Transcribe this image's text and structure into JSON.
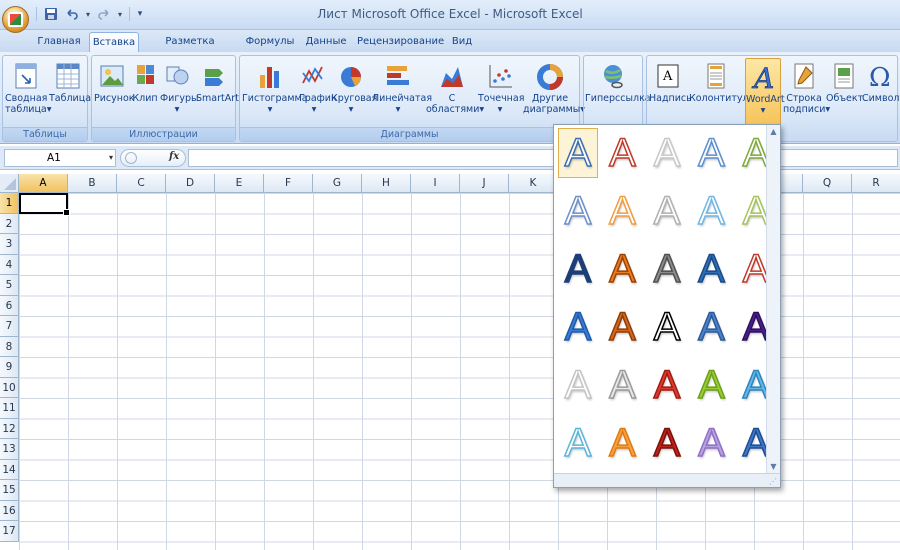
{
  "window": {
    "title": "Лист Microsoft Office Excel - Microsoft Excel"
  },
  "qat": {
    "save_icon": "save-icon",
    "undo_icon": "undo-icon",
    "redo_icon": "redo-icon"
  },
  "tabs": [
    {
      "label": "Главная"
    },
    {
      "label": "Вставка"
    },
    {
      "label": "Разметка страницы"
    },
    {
      "label": "Формулы"
    },
    {
      "label": "Данные"
    },
    {
      "label": "Рецензирование"
    },
    {
      "label": "Вид"
    }
  ],
  "ribbon": {
    "groups": {
      "tables": "Таблицы",
      "illustrations": "Иллюстрации",
      "charts": "Диаграммы"
    },
    "buttons": {
      "pivot_l1": "Сводная",
      "pivot_l2": "таблица",
      "table": "Таблица",
      "picture": "Рисунок",
      "clip": "Клип",
      "shapes": "Фигуры",
      "smartart": "SmartArt",
      "histogram": "Гистограмма",
      "graph": "График",
      "pie": "Круговая",
      "linear": "Линейчатая",
      "area_l1": "С",
      "area_l2": "областями",
      "scatter": "Точечная",
      "other_l1": "Другие",
      "other_l2": "диаграммы",
      "hyperlink": "Гиперссылка",
      "textbox": "Надпись",
      "header": "Колонтитулы",
      "wordart": "WordArt",
      "sigline_l1": "Строка",
      "sigline_l2": "подписи",
      "object": "Объект",
      "symbol": "Символ"
    },
    "dropdown_arrow": "▾"
  },
  "formula_bar": {
    "name_box": "A1",
    "fx": "fx",
    "value": ""
  },
  "sheet": {
    "columns": [
      "A",
      "B",
      "C",
      "D",
      "E",
      "F",
      "G",
      "H",
      "I",
      "J",
      "K",
      "L",
      "M",
      "N",
      "O",
      "P",
      "Q",
      "R"
    ],
    "rows": [
      "1",
      "2",
      "3",
      "4",
      "5",
      "6",
      "7",
      "8",
      "9",
      "10",
      "11",
      "12",
      "13",
      "14",
      "15",
      "16",
      "17"
    ],
    "active_cell": "A1"
  },
  "wordart_gallery": {
    "glyph": "A",
    "rows": 6,
    "cols": 5,
    "styles": [
      {
        "fill": "#ffffff",
        "stroke": "#3a6fb0"
      },
      {
        "fill": "#ffffff",
        "stroke": "#c0392b"
      },
      {
        "fill": "#ffffff",
        "stroke": "#c8c8c8"
      },
      {
        "fill": "#ffffff",
        "stroke": "#5b8fd0"
      },
      {
        "fill": "#ffffff",
        "stroke": "#7ea93a"
      },
      {
        "fill": "#ffffff",
        "stroke": "#6a8fc9"
      },
      {
        "fill": "#ffffff",
        "stroke": "#f39c3c"
      },
      {
        "fill": "#ffffff",
        "stroke": "#b0b0b0"
      },
      {
        "fill": "#ffffff",
        "stroke": "#6fb7e5"
      },
      {
        "fill": "#ffffff",
        "stroke": "#a5c45a"
      },
      {
        "fill": "#1d3f78",
        "stroke": "#1d3f78"
      },
      {
        "fill": "#e67e22",
        "stroke": "#a04000"
      },
      {
        "fill": "#8c8c8c",
        "stroke": "#505050"
      },
      {
        "fill": "#2e6db8",
        "stroke": "#1b4a86"
      },
      {
        "fill": "#ffffff",
        "stroke": "#c0392b"
      },
      {
        "fill": "#3a7bd5",
        "stroke": "#1f5aa8"
      },
      {
        "fill": "#d9681c",
        "stroke": "#8f3c08"
      },
      {
        "fill": "#ffffff",
        "stroke": "#000000"
      },
      {
        "fill": "#4d82c9",
        "stroke": "#2c5a99"
      },
      {
        "fill": "#4b1f8a",
        "stroke": "#2e0f5e"
      },
      {
        "fill": "#ffffff",
        "stroke": "#c4c4c4"
      },
      {
        "fill": "#e8e8e8",
        "stroke": "#9a9a9a"
      },
      {
        "fill": "#e03a2f",
        "stroke": "#a11d14"
      },
      {
        "fill": "#9acd32",
        "stroke": "#6b9f1c"
      },
      {
        "fill": "#67b8e8",
        "stroke": "#2a85c0"
      },
      {
        "fill": "#ffffff",
        "stroke": "#5ab6d8"
      },
      {
        "fill": "#f5a340",
        "stroke": "#e07a10"
      },
      {
        "fill": "#c0221a",
        "stroke": "#7a110b"
      },
      {
        "fill": "#b9a2e0",
        "stroke": "#8f6fc8"
      },
      {
        "fill": "#3e79c8",
        "stroke": "#1d4d94"
      }
    ]
  }
}
